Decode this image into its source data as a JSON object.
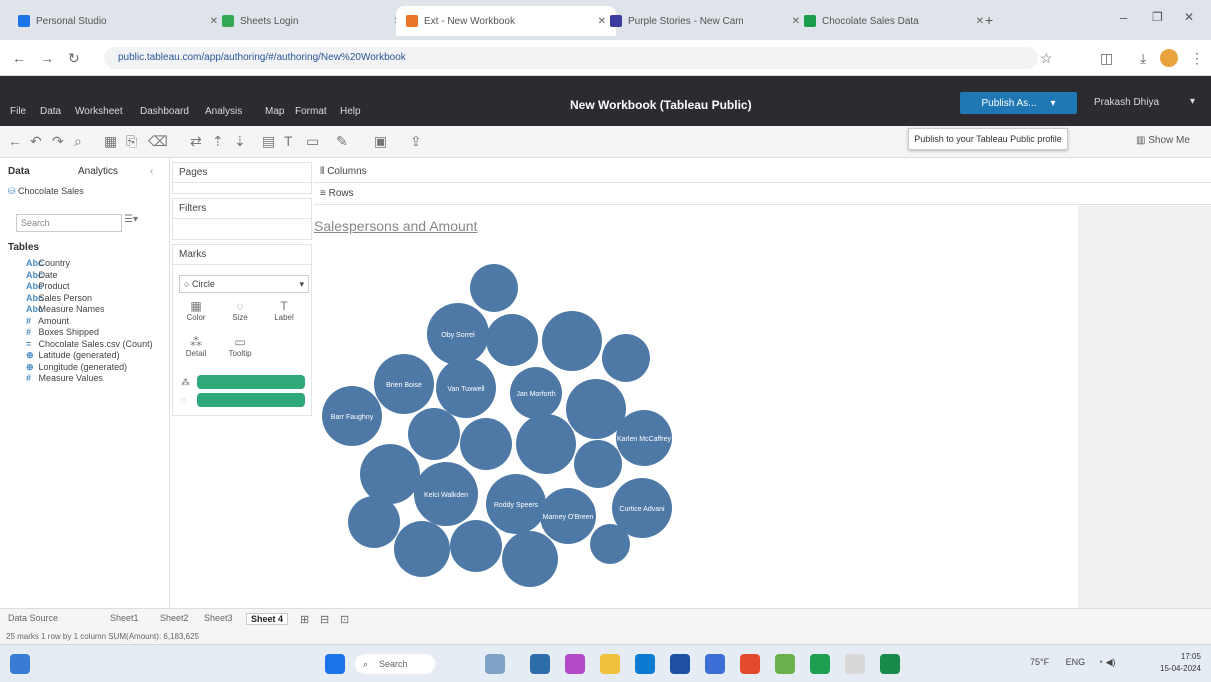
{
  "browser": {
    "tabs": [
      {
        "label": "Personal Studio"
      },
      {
        "label": "Sheets Login"
      },
      {
        "label": "Ext - New Workbook"
      },
      {
        "label": "Purple Stories - New Cam"
      },
      {
        "label": "Chocolate Sales Data"
      }
    ],
    "url": "public.tableau.com/app/authoring/#/authoring/New%20Workbook"
  },
  "tableau": {
    "menus": [
      "File",
      "Data",
      "Worksheet",
      "Dashboard",
      "Analysis",
      "Map",
      "Format",
      "Help"
    ],
    "workbook_title": "New Workbook (Tableau Public)",
    "save_button": "Publish As...",
    "save_tooltip": "Publish to your Tableau Public profile",
    "user": "Prakash Dhiya",
    "show_me": "Show Me"
  },
  "data_pane": {
    "tabs": [
      "Data",
      "Analytics"
    ],
    "source": "Chocolate Sales",
    "search_placeholder": "Search",
    "section": "Tables",
    "fields": [
      {
        "icon": "Abc",
        "label": "Country"
      },
      {
        "icon": "Abc",
        "label": "Date"
      },
      {
        "icon": "Abc",
        "label": "Product"
      },
      {
        "icon": "Abc",
        "label": "Sales Person"
      },
      {
        "icon": "Abc",
        "label": "Measure Names"
      },
      {
        "icon": "#",
        "label": "Amount"
      },
      {
        "icon": "#",
        "label": "Boxes Shipped"
      },
      {
        "icon": "=",
        "label": "Chocolate Sales.csv (Count)"
      },
      {
        "icon": "⊕",
        "label": "Latitude (generated)"
      },
      {
        "icon": "⊕",
        "label": "Longitude (generated)"
      },
      {
        "icon": "#",
        "label": "Measure Values"
      }
    ]
  },
  "shelves": {
    "pages": "Pages",
    "filters": "Filters",
    "marks": "Marks",
    "mark_type": "Circle",
    "mark_buttons": [
      "Color",
      "Size",
      "Label",
      "Detail",
      "Tooltip"
    ],
    "columns": "Columns",
    "rows": "Rows"
  },
  "viz": {
    "title": "Salespersons and Amount",
    "bubble_labels": [
      "Barr Faughny",
      "Brien Boise",
      "Van Tuxwell",
      "Oby Sorrel",
      "Kelci Walkden",
      "Roddy Speers",
      "Curtice Advani",
      "Karlen McCaffrey",
      "Marney O'Breen",
      "Jan Morforth"
    ]
  },
  "sheet_tabs": [
    "Data Source",
    "Sheet1",
    "Sheet2",
    "Sheet3",
    "Sheet 4"
  ],
  "active_sheet": "Sheet 4",
  "status": "25 marks    1 row by 1 column    SUM(Amount): 6,183,625",
  "taskbar": {
    "search_placeholder": "Search",
    "weather": "75°F",
    "lang": "ENG",
    "time": "17:05",
    "date": "15-04-2024"
  }
}
